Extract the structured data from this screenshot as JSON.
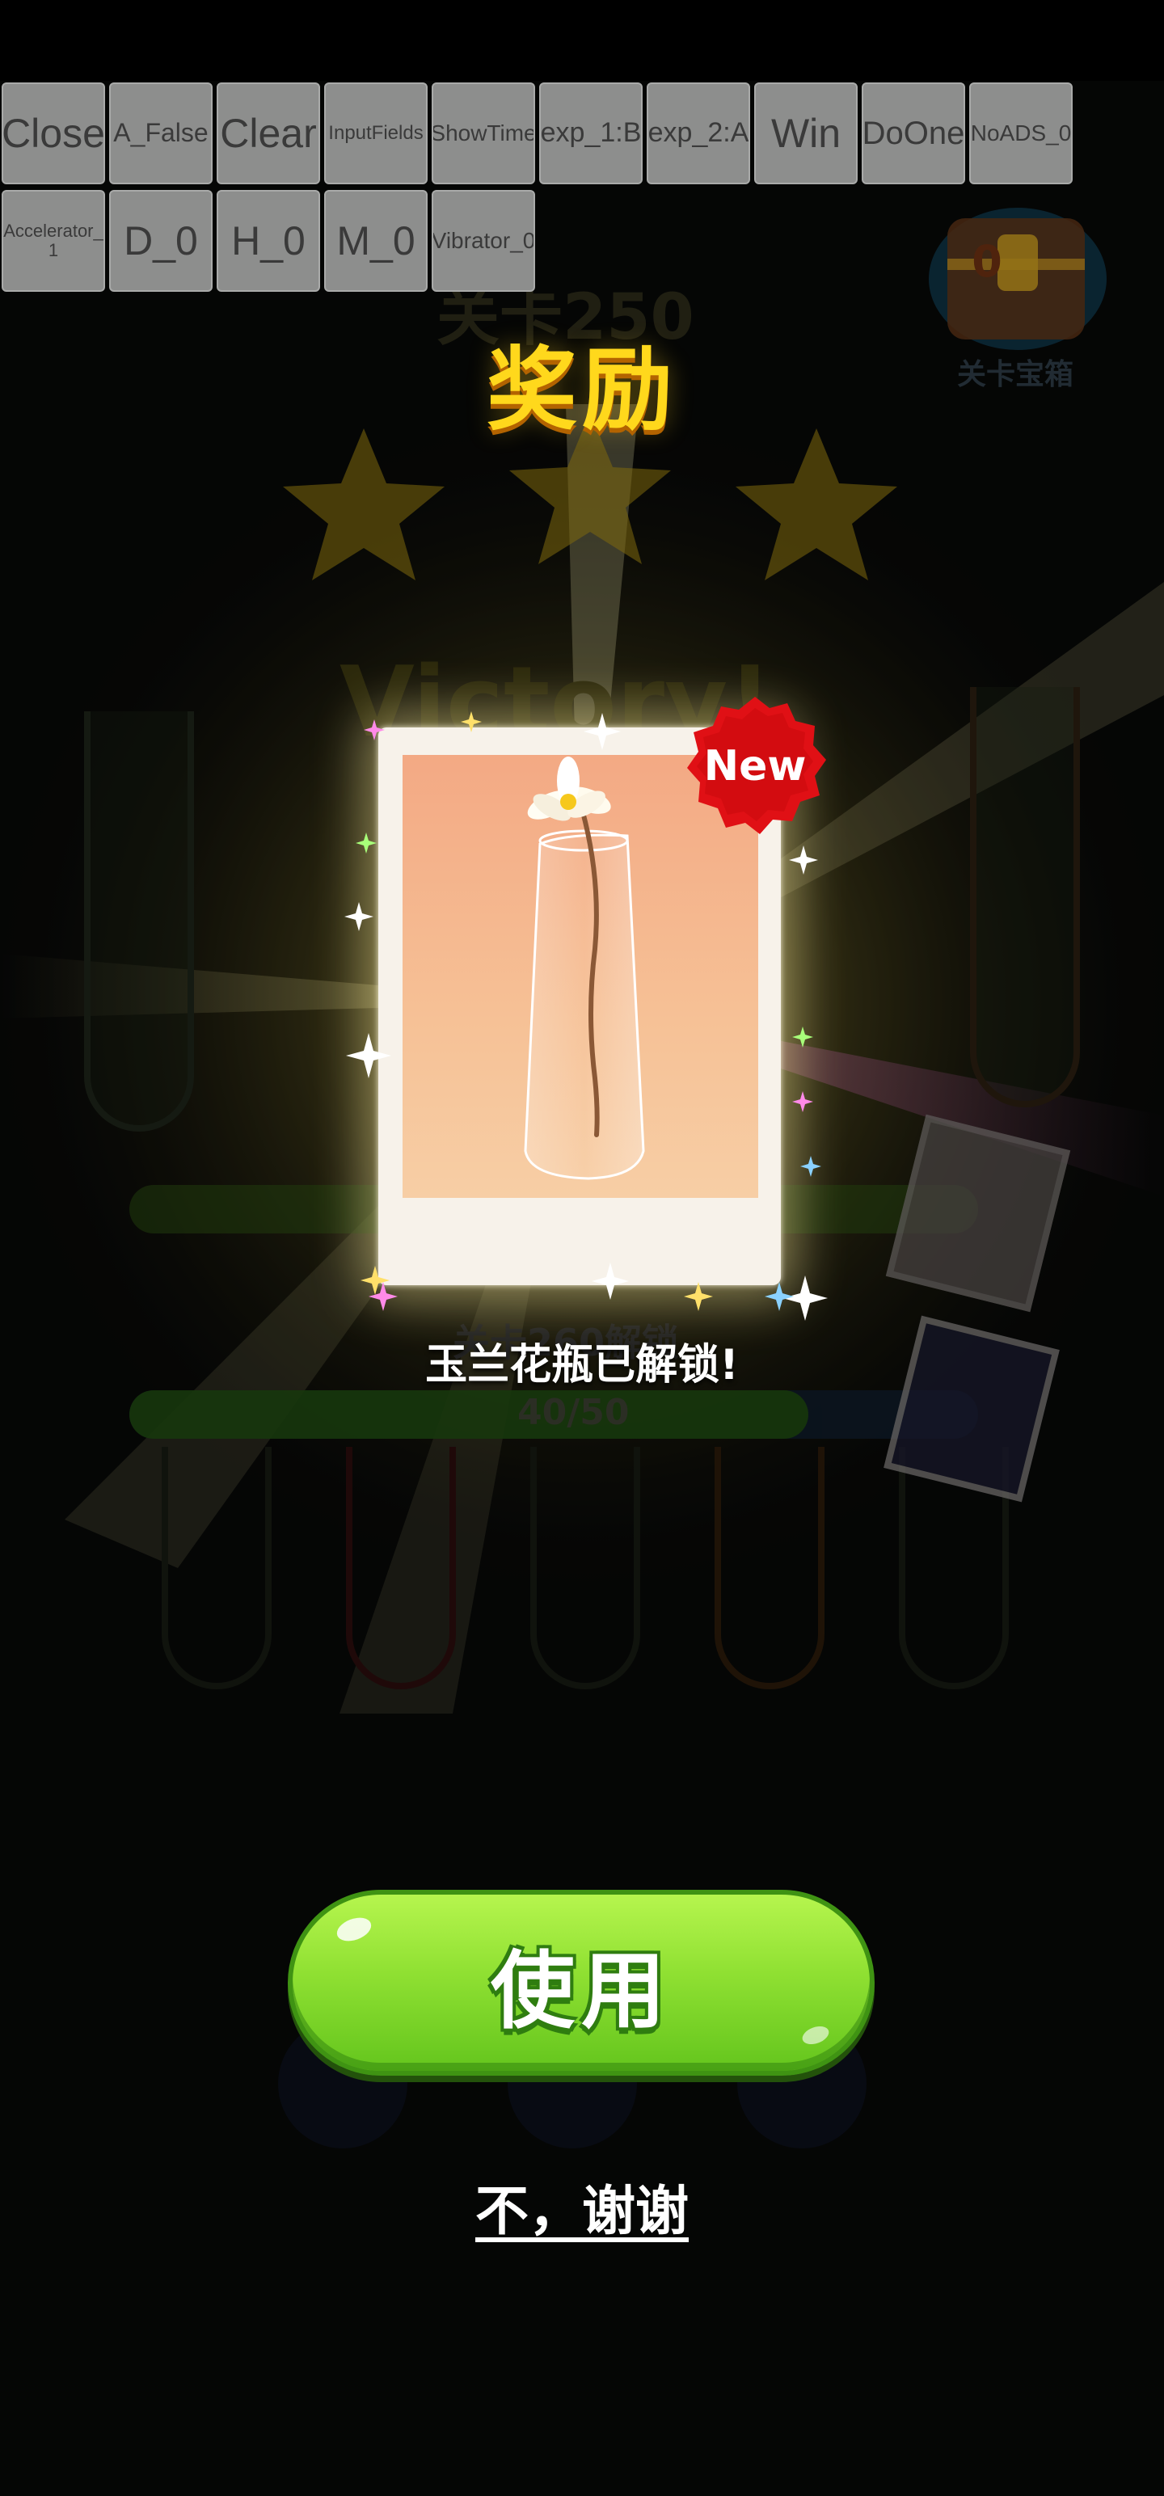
{
  "debug_buttons": [
    {
      "label": "Close",
      "size": 50
    },
    {
      "label": "A_False",
      "size": 32
    },
    {
      "label": "Clear",
      "size": 50
    },
    {
      "label": "InputFields",
      "size": 24
    },
    {
      "label": "ShowTime",
      "size": 28
    },
    {
      "label": "exp_1:B",
      "size": 34
    },
    {
      "label": "exp_2:A",
      "size": 34
    },
    {
      "label": "Win",
      "size": 50
    },
    {
      "label": "DoOne",
      "size": 40
    },
    {
      "label": "NoADS_0",
      "size": 28
    },
    {
      "label": "Accelerator_\n1",
      "size": 22
    },
    {
      "label": "D_0",
      "size": 50
    },
    {
      "label": "H_0",
      "size": 50
    },
    {
      "label": "M_0",
      "size": 50
    },
    {
      "label": "Vibrator_0",
      "size": 28
    }
  ],
  "background": {
    "level_title": "关卡250",
    "victory_text": "Victory!",
    "unlock_hint": "关卡260解锁",
    "progress_text": "40/50",
    "progress_fraction": 0.8,
    "chest_label": "关卡宝箱",
    "chest_count": "0"
  },
  "reward_popup": {
    "title": "奖励",
    "badge": "New",
    "item_unlocked_text": "玉兰花瓶已解锁!",
    "use_button": "使用",
    "decline_link": "不，谢谢"
  },
  "colors": {
    "title": "#ffd81c",
    "use_button": "#8fe032",
    "badge": "#e01015"
  }
}
